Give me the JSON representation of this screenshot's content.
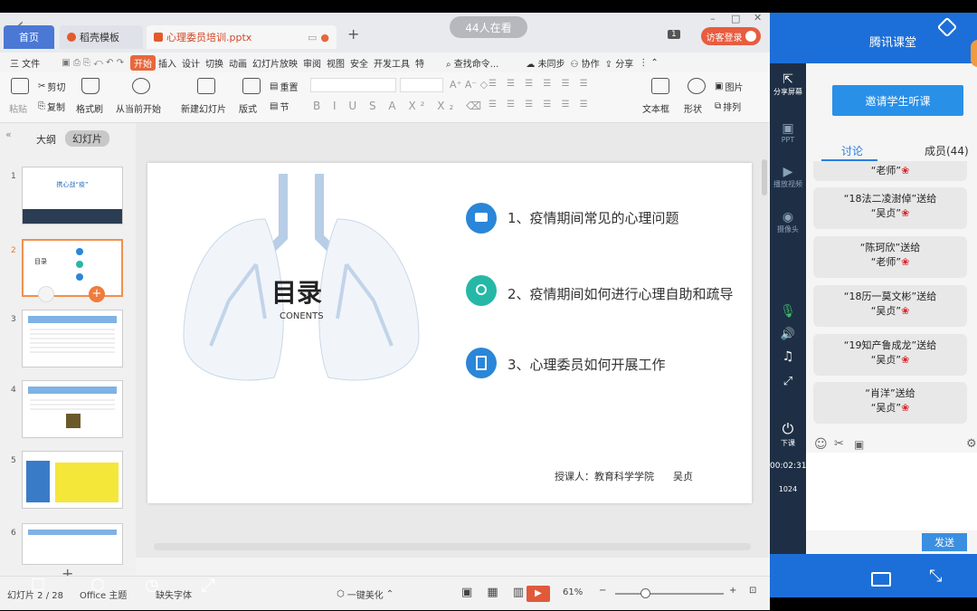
{
  "titlebar": {
    "tab_home": "首页",
    "tab_template": "稻壳模板",
    "tab_file": "心理委员培训.pptx",
    "viewers": "44人在看",
    "badge": "1",
    "guest": "访客登录"
  },
  "menubar": {
    "file": "三 文件",
    "start": "开始",
    "items": [
      "插入",
      "设计",
      "切换",
      "动画",
      "幻灯片放映",
      "审阅",
      "视图",
      "安全",
      "开发工具",
      "特"
    ],
    "search": "查找命令...",
    "sync": "未同步",
    "collab": "协作",
    "share": "分享"
  },
  "ribbon": {
    "paste": "粘贴",
    "cut": "剪切",
    "copy": "复制",
    "format_painter": "格式刷",
    "play_from": "从当前开始",
    "new_slide": "新建幻灯片",
    "layout": "版式",
    "section": "节",
    "reset": "重置",
    "textbox": "文本框",
    "shape": "形状",
    "arrange": "排列",
    "picture": "图片"
  },
  "leftpanel": {
    "outline": "大纲",
    "slides": "幻灯片",
    "slide_numbers": [
      "1",
      "2",
      "3",
      "4",
      "5",
      "6"
    ]
  },
  "slide": {
    "title": "目录",
    "subtitle": "CONENTS",
    "items": [
      "1、疫情期间常见的心理问题",
      "2、疫情期间如何进行心理自助和疏导",
      "3、心理委员如何开展工作"
    ],
    "item_colors": [
      "#2a86d8",
      "#26b8a6",
      "#2a86d8"
    ],
    "footer": "授课人：教育科学学院      吴贞",
    "thumb1_title": "携心战“疫”",
    "thumb2_title": "目录"
  },
  "statusbar": {
    "slide_count": "幻灯片 2 / 28",
    "office_theme": "Office 主题",
    "missing_font": "缺失字体",
    "beautify": "一键美化",
    "zoom": "61%"
  },
  "tencent": {
    "brand": "腾讯课堂",
    "invite": "邀请学生听课",
    "tab_discuss": "讨论",
    "tab_members": "成员(44)",
    "share_screen": "分享屏幕",
    "ppt": "PPT",
    "play_video": "播放视频",
    "camera": "摄像头",
    "end_class": "下课",
    "timer": "00:02:31",
    "bandwidth": "1024",
    "send": "发送",
    "messages": [
      {
        "from": "",
        "to": "“老师”"
      },
      {
        "from": "“18法二凌澍倬”送给",
        "to": "“吴贞”"
      },
      {
        "from": "“陈珂欣”送给",
        "to": "“老师”"
      },
      {
        "from": "“18历一莫文彬”送给",
        "to": "“吴贞”"
      },
      {
        "from": "“19知产鲁成龙”送给",
        "to": "“吴贞”"
      },
      {
        "from": "“肖洋”送给",
        "to": "“吴贞”"
      }
    ]
  }
}
